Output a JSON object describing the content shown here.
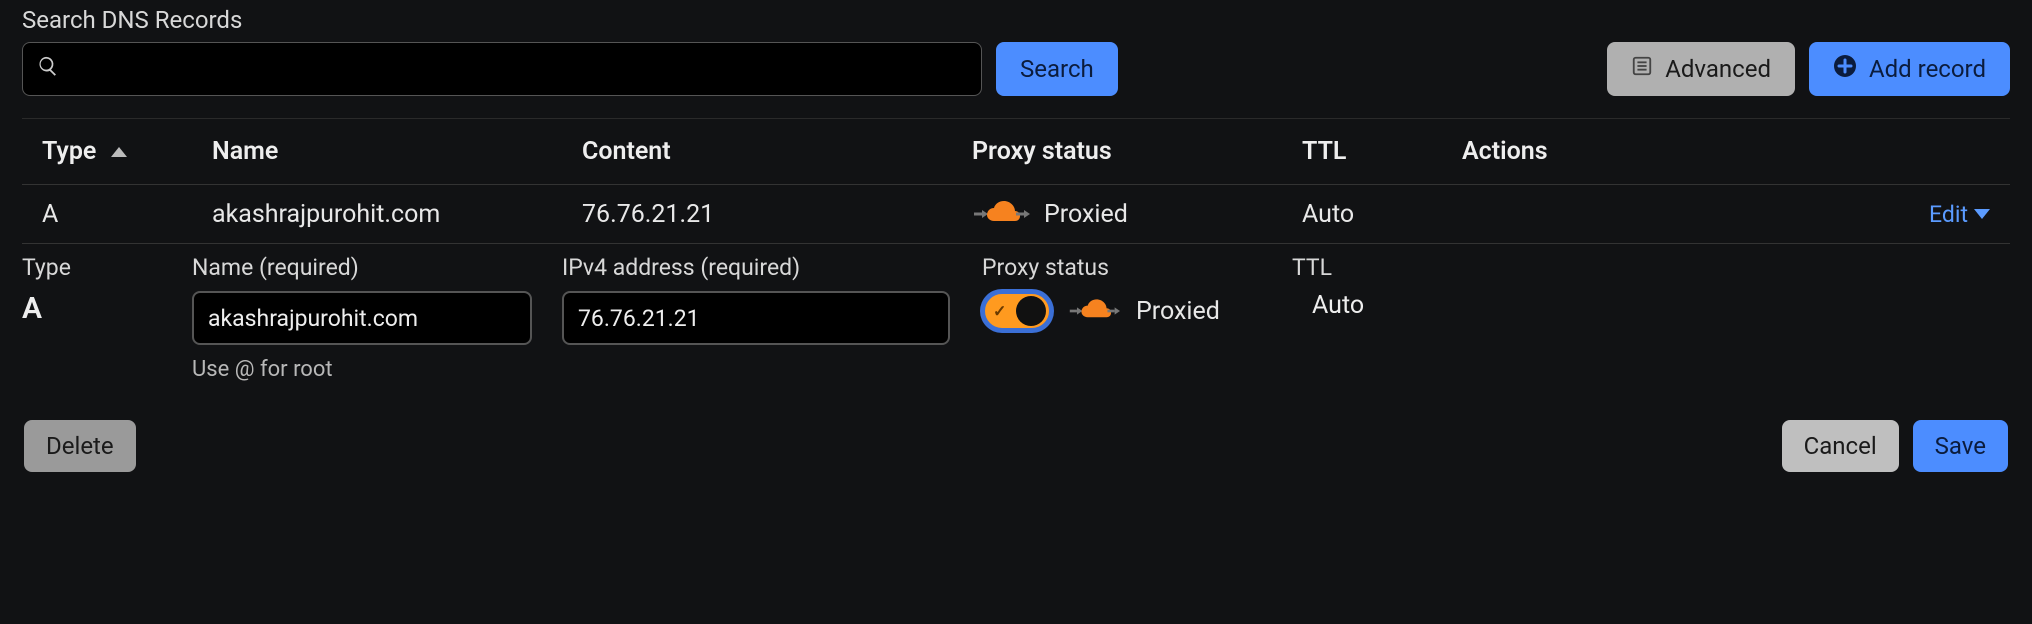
{
  "search_section": {
    "label": "Search DNS Records",
    "placeholder": ""
  },
  "toolbar": {
    "search_label": "Search",
    "advanced_label": "Advanced",
    "add_record_label": "Add record"
  },
  "table": {
    "headers": {
      "type": "Type",
      "name": "Name",
      "content": "Content",
      "proxy_status": "Proxy status",
      "ttl": "TTL",
      "actions": "Actions"
    },
    "row": {
      "type": "A",
      "name": "akashrajpurohit.com",
      "content": "76.76.21.21",
      "proxy_status": "Proxied",
      "ttl": "Auto",
      "edit_label": "Edit"
    }
  },
  "edit": {
    "type_label": "Type",
    "type_value": "A",
    "name_label": "Name (required)",
    "name_value": "akashrajpurohit.com",
    "name_helper": "Use @ for root",
    "content_label": "IPv4 address (required)",
    "content_value": "76.76.21.21",
    "proxy_label": "Proxy status",
    "proxy_value": "Proxied",
    "ttl_label": "TTL",
    "ttl_value": "Auto"
  },
  "footer": {
    "delete_label": "Delete",
    "cancel_label": "Cancel",
    "save_label": "Save"
  }
}
